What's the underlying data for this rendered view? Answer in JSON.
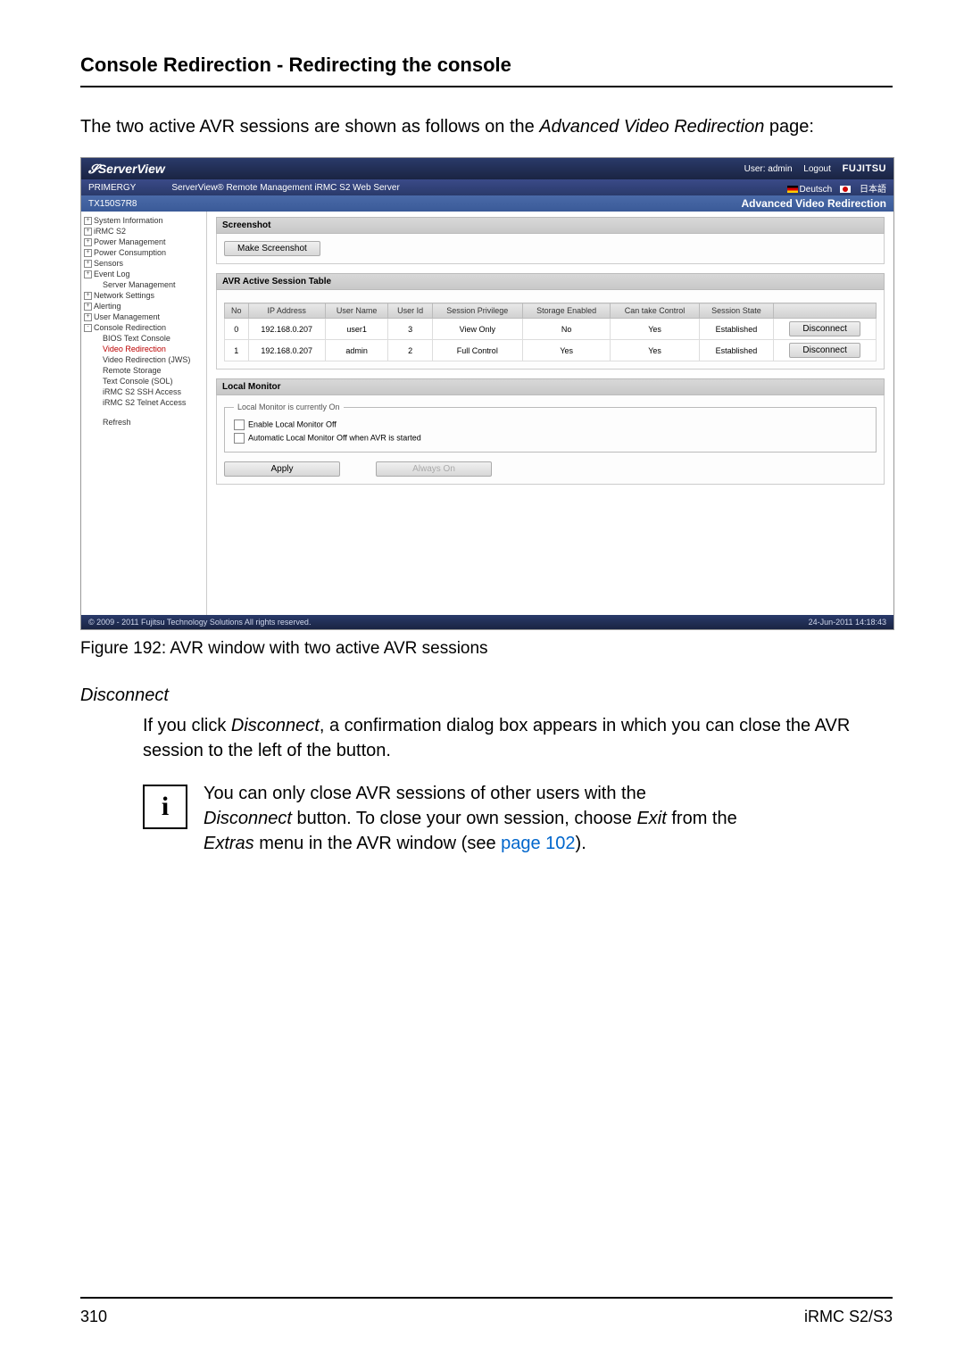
{
  "section_title": "Console Redirection - Redirecting the console",
  "intro_prefix": "The two active AVR sessions are shown as follows on the ",
  "intro_italic": "Advanced Video Redirection",
  "intro_suffix": " page:",
  "caption": "Figure 192: AVR window with two active AVR sessions",
  "subhead": "Disconnect",
  "disc_p1_a": "If you click ",
  "disc_p1_b": "Disconnect",
  "disc_p1_c": ", a confirmation dialog box appears in which you can close the AVR session to the left of the button.",
  "info_l1": "You can only close AVR sessions of other users with the ",
  "info_l2_a": "Disconnect",
  "info_l2_b": " button. To close your own session, choose ",
  "info_l2_c": "Exit",
  "info_l2_d": " from the ",
  "info_l3_a": "Extras",
  "info_l3_b": " menu in the AVR window (see ",
  "info_l3_link": "page 102",
  "info_l3_c": ").",
  "page_no": "310",
  "doc_id": "iRMC S2/S3",
  "shot": {
    "brand": "ServerView",
    "user_label": "User: admin",
    "logout": "Logout",
    "vendor": "FUJITSU",
    "product": "PRIMERGY",
    "subtitle": "ServerView® Remote Management iRMC S2 Web Server",
    "lang1": "Deutsch",
    "lang2": "日本語",
    "model": "TX150S7R8",
    "page_title": "Advanced Video Redirection",
    "side": [
      {
        "l": "System Information",
        "exp": "+"
      },
      {
        "l": "iRMC S2",
        "exp": "+"
      },
      {
        "l": "Power Management",
        "exp": "+"
      },
      {
        "l": "Power Consumption",
        "exp": "+"
      },
      {
        "l": "Sensors",
        "exp": "+"
      },
      {
        "l": "Event Log",
        "exp": "+"
      },
      {
        "l": "Server Management",
        "sub": true
      },
      {
        "l": "Network Settings",
        "exp": "+"
      },
      {
        "l": "Alerting",
        "exp": "+"
      },
      {
        "l": "User Management",
        "exp": "+"
      },
      {
        "l": "Console Redirection",
        "exp": "-"
      },
      {
        "l": "BIOS Text Console",
        "sub": true
      },
      {
        "l": "Video Redirection",
        "sub": true,
        "sel": true
      },
      {
        "l": "Video Redirection (JWS)",
        "sub": true
      },
      {
        "l": "Remote Storage",
        "sub": true
      },
      {
        "l": "Text Console (SOL)",
        "sub": true
      },
      {
        "l": "iRMC S2 SSH Access",
        "sub": true
      },
      {
        "l": "iRMC S2 Telnet Access",
        "sub": true
      },
      {
        "l": "Refresh",
        "sub": true,
        "gap": true
      }
    ],
    "panel1": {
      "title": "Screenshot",
      "btn": "Make Screenshot"
    },
    "panel2": {
      "title": "AVR Active Session Table",
      "headers": [
        "No",
        "IP Address",
        "User Name",
        "User Id",
        "Session Privilege",
        "Storage Enabled",
        "Can take Control",
        "Session State",
        ""
      ],
      "rows": [
        {
          "no": "0",
          "ip": "192.168.0.207",
          "un": "user1",
          "uid": "3",
          "priv": "View Only",
          "stor": "No",
          "ctrl": "Yes",
          "state": "Established",
          "btn": "Disconnect"
        },
        {
          "no": "1",
          "ip": "192.168.0.207",
          "un": "admin",
          "uid": "2",
          "priv": "Full Control",
          "stor": "Yes",
          "ctrl": "Yes",
          "state": "Established",
          "btn": "Disconnect"
        }
      ]
    },
    "panel3": {
      "title": "Local Monitor",
      "legend": "Local Monitor is currently On",
      "cb1": "Enable Local Monitor Off",
      "cb2": "Automatic Local Monitor Off when AVR is started",
      "apply": "Apply",
      "always": "Always On"
    },
    "footer_l": "© 2009 - 2011 Fujitsu Technology Solutions All rights reserved.",
    "footer_r": "24-Jun-2011 14:18:43"
  }
}
